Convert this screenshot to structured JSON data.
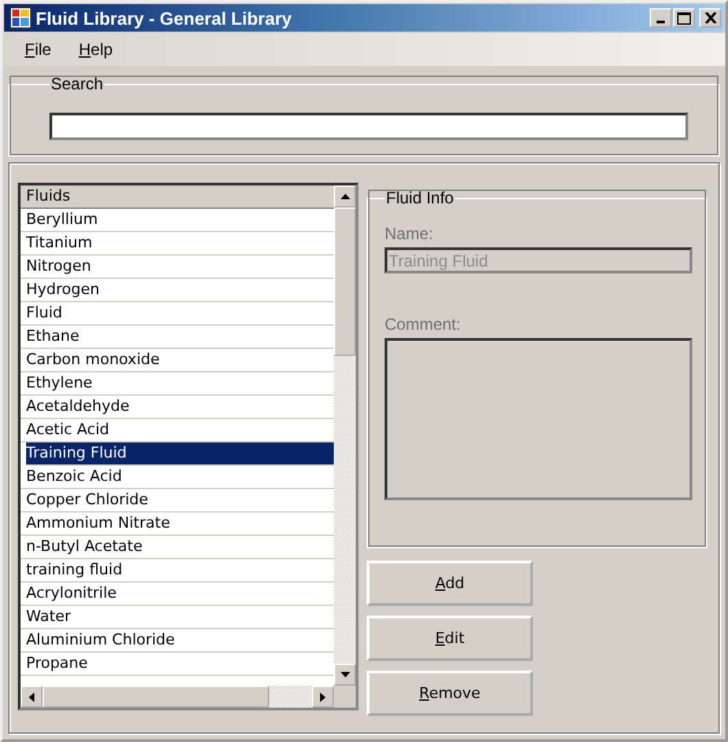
{
  "window": {
    "title": "Fluid Library - General Library"
  },
  "menu": [
    {
      "label": "File",
      "underline_first": true
    },
    {
      "label": "Help",
      "underline_first": true
    }
  ],
  "search": {
    "title": "Search"
  },
  "fluids": {
    "header": "Fluids",
    "items": [
      {
        "label": "Beryllium",
        "selected": false
      },
      {
        "label": "Titanium",
        "selected": false
      },
      {
        "label": "Nitrogen",
        "selected": false
      },
      {
        "label": "Hydrogen",
        "selected": false
      },
      {
        "label": "Fluid",
        "selected": false
      },
      {
        "label": "Ethane",
        "selected": false
      },
      {
        "label": "Carbon monoxide",
        "selected": false
      },
      {
        "label": "Ethylene",
        "selected": false
      },
      {
        "label": "Acetaldehyde",
        "selected": false
      },
      {
        "label": "Acetic Acid",
        "selected": false
      },
      {
        "label": "Training Fluid",
        "selected": true
      },
      {
        "label": "Benzoic Acid",
        "selected": false
      },
      {
        "label": "Copper Chloride",
        "selected": false
      },
      {
        "label": "Ammonium Nitrate",
        "selected": false
      },
      {
        "label": "n-Butyl Acetate",
        "selected": false
      },
      {
        "label": "training fluid",
        "selected": false
      },
      {
        "label": "Acrylonitrile",
        "selected": false
      },
      {
        "label": "Water",
        "selected": false
      },
      {
        "label": "Aluminium Chloride",
        "selected": false
      },
      {
        "label": "Propane",
        "selected": false
      }
    ]
  },
  "fluid_info": {
    "title": "Fluid Info",
    "name_label": "Name:",
    "name_value": "Training Fluid",
    "name_disabled": true,
    "comment_label": "Comment:",
    "comment_disabled": true
  },
  "buttons": [
    {
      "label": "Add",
      "underline_first": true
    },
    {
      "label": "Edit",
      "underline_first": true
    },
    {
      "label": "Remove",
      "underline_first": true
    }
  ]
}
